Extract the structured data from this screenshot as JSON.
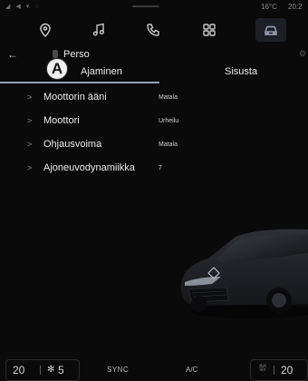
{
  "status_bar": {
    "signal_icons": "◢ ◀ ▾ ◌",
    "temperature": "16°C",
    "time": "20:2"
  },
  "top_nav": {
    "icons": [
      "navigation-icon",
      "music-icon",
      "phone-icon",
      "apps-icon",
      "car-icon"
    ],
    "active": "car-icon"
  },
  "header": {
    "back_glyph": "←",
    "title": "Perso"
  },
  "marker": {
    "label": "A"
  },
  "tabs": {
    "items": [
      {
        "label": "Ajaminen",
        "active": true
      },
      {
        "label": "Sisusta",
        "active": false
      }
    ]
  },
  "settings": {
    "rows": [
      {
        "label": "Moottorin ääni",
        "value": "Matala"
      },
      {
        "label": "Moottori",
        "value": "Urheilu"
      },
      {
        "label": "Ohjausvoima",
        "value": "Matala"
      },
      {
        "label": "Ajoneuvodynamiikka",
        "value": "7"
      }
    ]
  },
  "bottom_bar": {
    "temp_left": "20",
    "fan_level": "5",
    "sync_label": "SYNC",
    "ac_label": "A/C",
    "temp_right": "20"
  },
  "colors": {
    "background": "#0a0a0b",
    "active_tab_underline": "#9aa0ad",
    "active_nav_bg": "#1d1f26"
  }
}
